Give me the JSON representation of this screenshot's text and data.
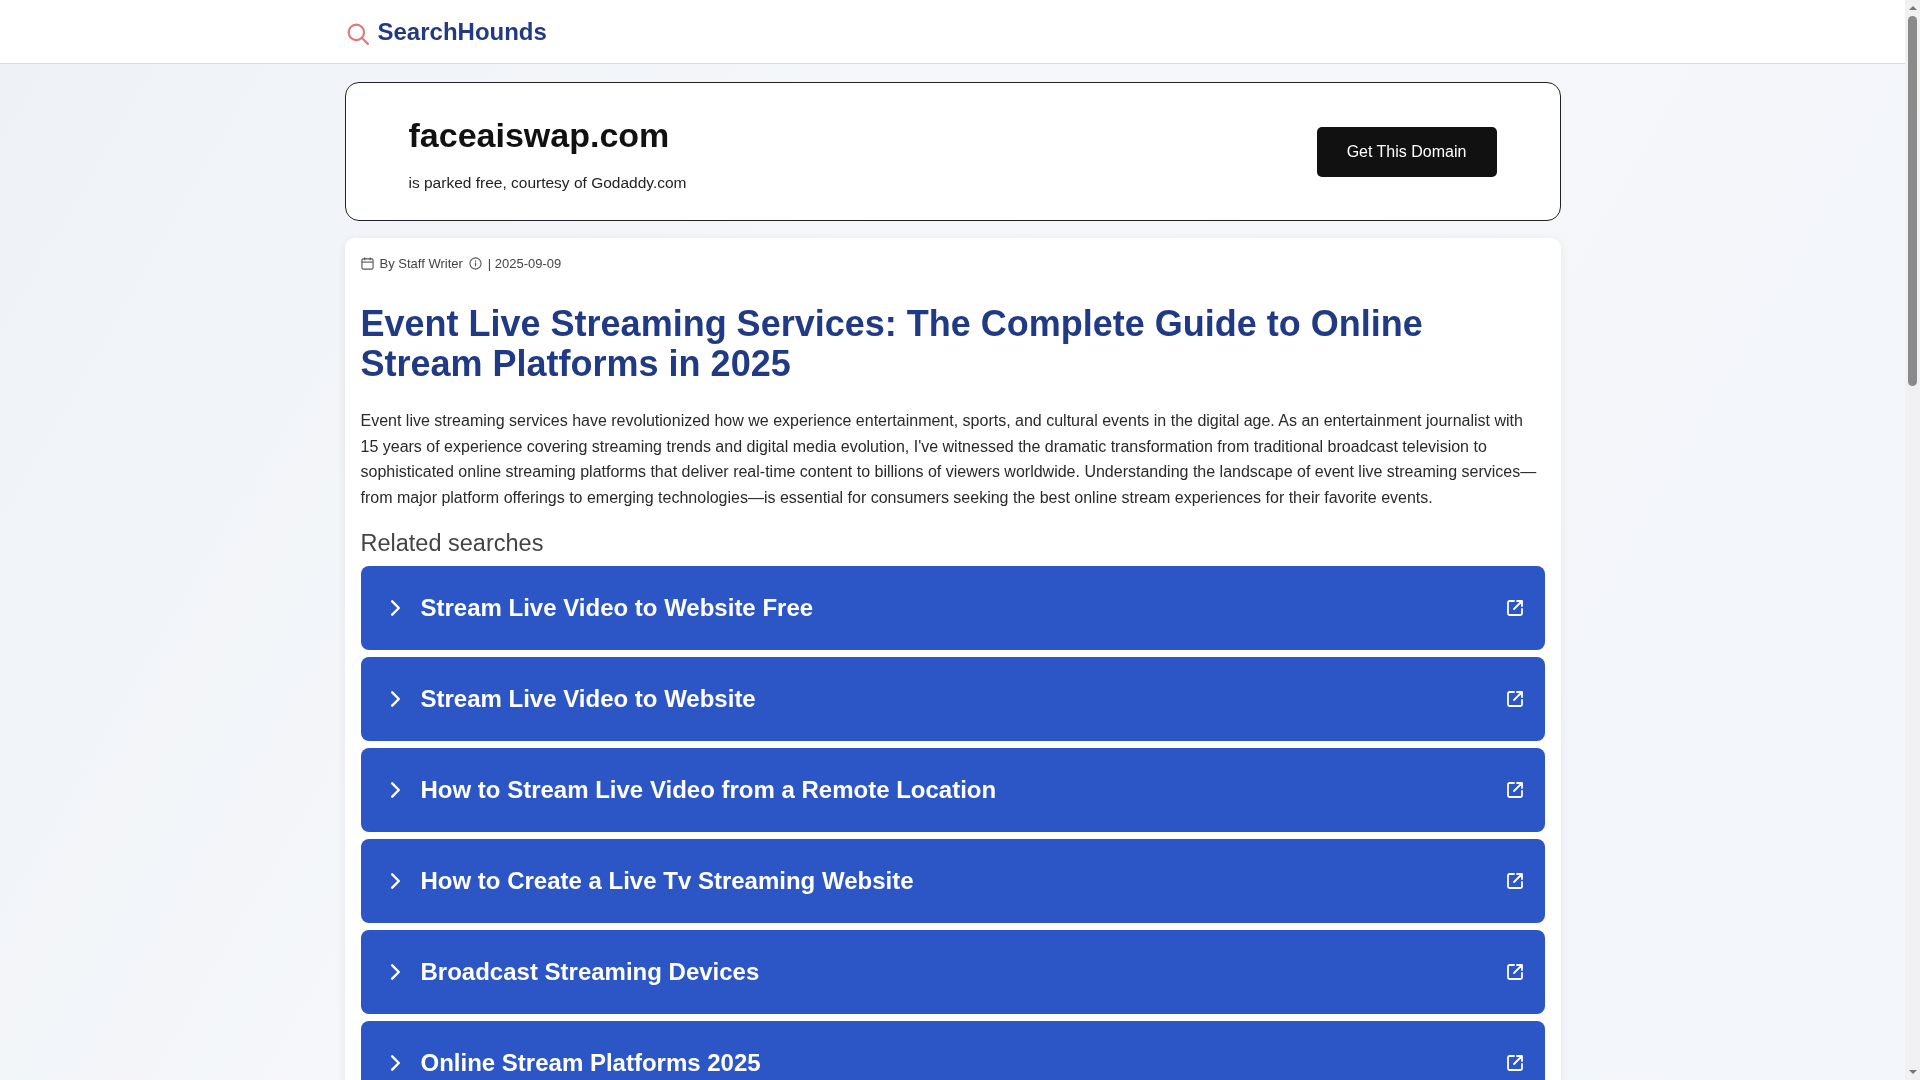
{
  "header": {
    "logo_text": "SearchHounds"
  },
  "domain_banner": {
    "domain": "faceaiswap.com",
    "note": "is parked free, courtesy of Godaddy.com",
    "button": "Get This Domain"
  },
  "article": {
    "author": "By Staff Writer",
    "date": "| 2025-09-09",
    "title": "Event Live Streaming Services: The Complete Guide to Online Stream Platforms in 2025",
    "body": "Event live streaming services have revolutionized how we experience entertainment, sports, and cultural events in the digital age. As an entertainment journalist with 15 years of experience covering streaming trends and digital media evolution, I've witnessed the dramatic transformation from traditional broadcast television to sophisticated online streaming platforms that deliver real-time content to billions of viewers worldwide. Understanding the landscape of event live streaming services—from major platform offerings to emerging technologies—is essential for consumers seeking the best online stream experiences for their favorite events."
  },
  "related_searches": {
    "heading": "Related searches",
    "items": [
      "Stream Live Video to Website Free",
      "Stream Live Video to Website",
      "How to Stream Live Video from a Remote Location",
      "How to Create a Live Tv Streaming Website",
      "Broadcast Streaming Devices",
      "Online Stream Platforms 2025"
    ]
  }
}
